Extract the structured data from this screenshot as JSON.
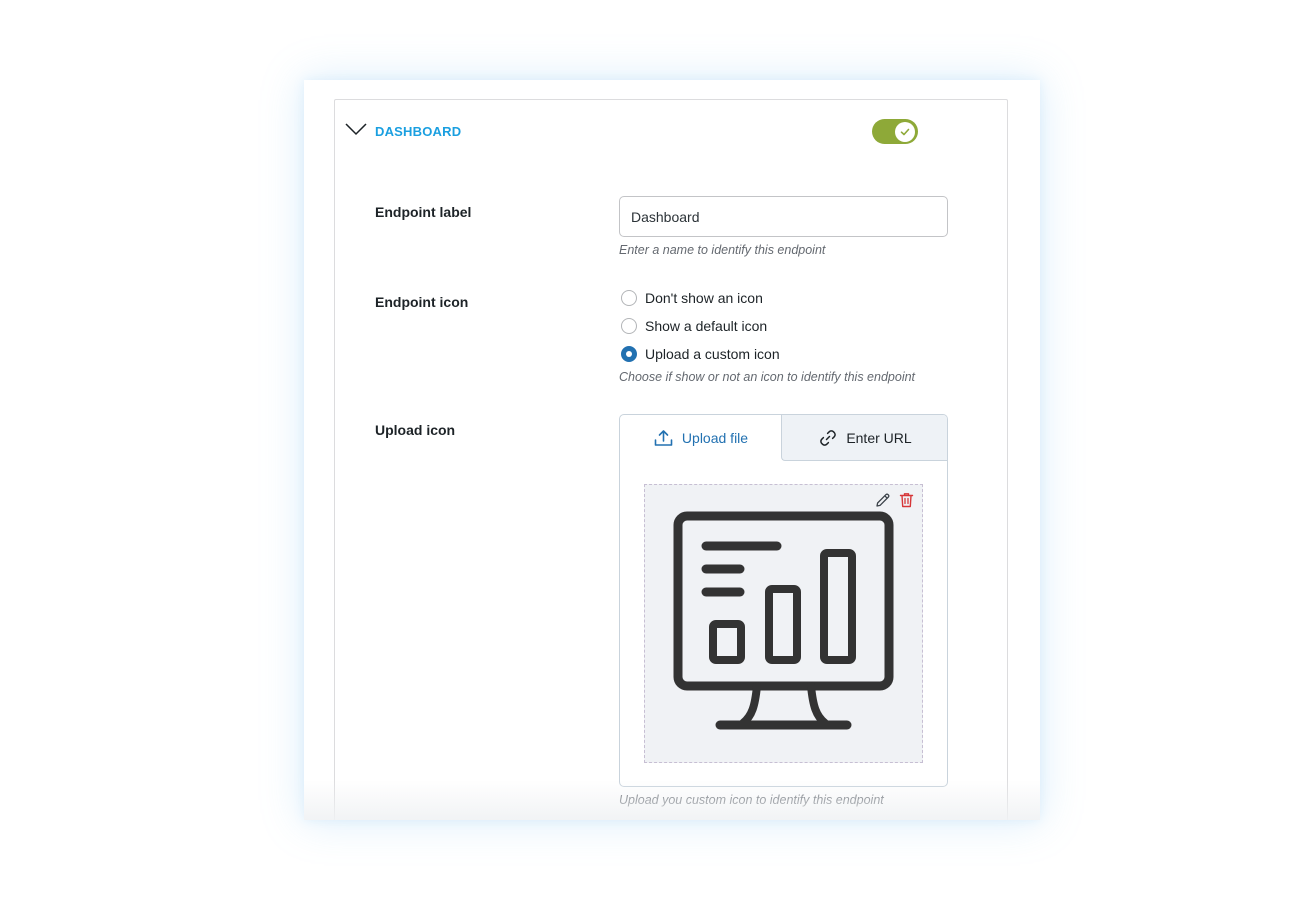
{
  "section": {
    "title": "DASHBOARD",
    "enabled": true
  },
  "fields": {
    "label": {
      "title": "Endpoint label",
      "value": "Dashboard",
      "description": "Enter a name to identify this endpoint"
    },
    "icon": {
      "title": "Endpoint icon",
      "options": [
        {
          "label": "Don't show an icon",
          "checked": false
        },
        {
          "label": "Show a default icon",
          "checked": false
        },
        {
          "label": "Upload a custom icon",
          "checked": true
        }
      ],
      "description": "Choose if show or not an icon to identify this endpoint"
    },
    "upload": {
      "title": "Upload icon",
      "tabs": {
        "upload_file": "Upload file",
        "enter_url": "Enter URL"
      },
      "active_tab": "upload_file",
      "preview_icon": "monitor-chart-icon",
      "description": "Upload you custom icon to identify this endpoint"
    }
  },
  "colors": {
    "accent_blue": "#1a9fe0",
    "toggle_green": "#8ea938",
    "radio_blue": "#2271b1",
    "delete_red": "#d63638"
  }
}
